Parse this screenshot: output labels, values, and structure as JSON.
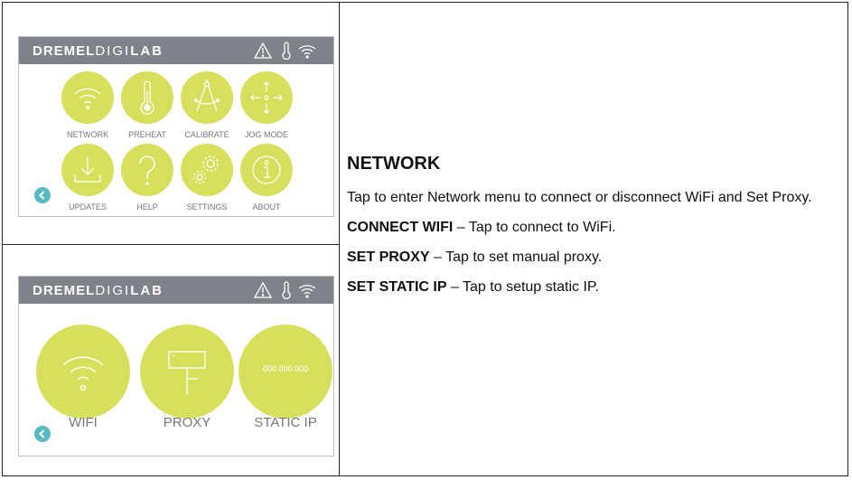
{
  "brand": {
    "part1": "DREMEL",
    "part2": "DIGI",
    "part3": "LAB"
  },
  "status_icons": [
    "warning-icon",
    "thermometer-icon",
    "wifi-icon"
  ],
  "screen1": {
    "items": [
      {
        "label": "NETWORK",
        "icon": "wifi-icon"
      },
      {
        "label": "PREHEAT",
        "icon": "thermometer-icon"
      },
      {
        "label": "CALIBRATE",
        "icon": "compass-icon"
      },
      {
        "label": "JOG MODE",
        "icon": "move-arrows-icon"
      },
      {
        "label": "UPDATES",
        "icon": "download-icon"
      },
      {
        "label": "HELP",
        "icon": "question-icon"
      },
      {
        "label": "SETTINGS",
        "icon": "gears-icon"
      },
      {
        "label": "ABOUT",
        "icon": "info-icon"
      }
    ]
  },
  "screen2": {
    "items": [
      {
        "label": "WIFI",
        "icon": "wifi-icon"
      },
      {
        "label": "PROXY",
        "icon": "proxy-icon"
      },
      {
        "label": "STATIC IP",
        "icon": "ip-address-icon",
        "value": "000.000.000"
      }
    ]
  },
  "colors": {
    "button": "#d7e05c",
    "titlebar": "#7f8288",
    "back": "#56b9c0",
    "label": "#777777"
  },
  "description": {
    "heading": "NETWORK",
    "intro": "Tap to enter Network menu to connect or disconnect WiFi and Set Proxy.",
    "lines": [
      {
        "term": "CONNECT WIFI",
        "text": " – Tap to connect to WiFi."
      },
      {
        "term": "SET PROXY",
        "text": " – Tap to set manual proxy."
      },
      {
        "term": "SET STATIC IP",
        "text": " – Tap to setup static IP."
      }
    ]
  }
}
